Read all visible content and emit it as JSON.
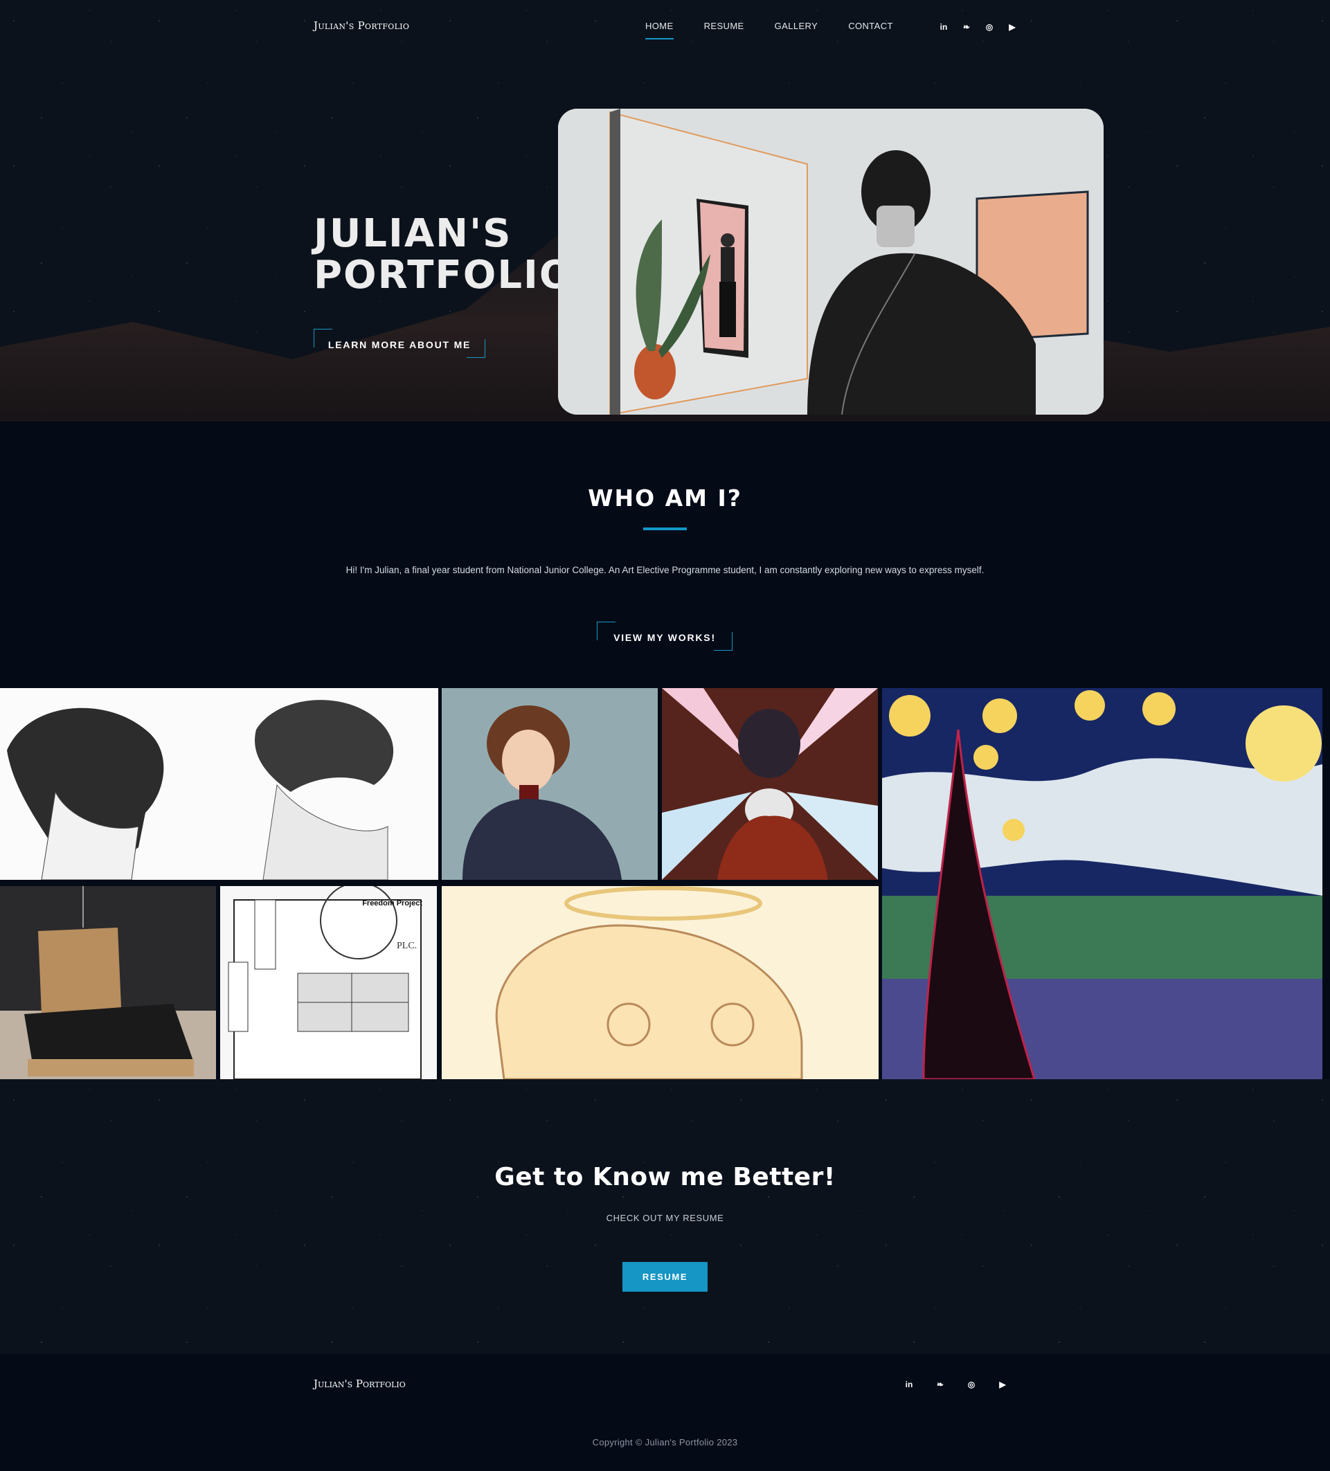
{
  "header": {
    "brand": "Julian's Portfolio",
    "nav": [
      {
        "label": "HOME",
        "active": true
      },
      {
        "label": "RESUME",
        "active": false
      },
      {
        "label": "GALLERY",
        "active": false
      },
      {
        "label": "CONTACT",
        "active": false
      }
    ],
    "socials": [
      {
        "icon": "linkedin-icon",
        "glyph": "in"
      },
      {
        "icon": "twitter-icon",
        "glyph": "❧"
      },
      {
        "icon": "instagram-icon",
        "glyph": "◎"
      },
      {
        "icon": "youtube-icon",
        "glyph": "▶"
      }
    ]
  },
  "hero": {
    "title_line1": "JULIAN'S",
    "title_line2": "PORTFOLIO",
    "cta": "LEARN MORE ABOUT ME"
  },
  "about": {
    "title": "WHO AM I?",
    "text": "Hi! I'm Julian, a final year student from National Junior College. An Art Elective Programme student, I am constantly exploring new ways to express myself.",
    "cta": "VIEW MY WORKS!"
  },
  "gallery": {
    "manga_page_label": "Freedom Project",
    "manga_sign": "PLC."
  },
  "resume_cta": {
    "title": "Get to Know me Better!",
    "subtitle": "CHECK OUT MY RESUME",
    "button": "RESUME"
  },
  "footer": {
    "brand": "Julian's Portfolio",
    "copyright": "Copyright © Julian's Portfolio 2023"
  },
  "colors": {
    "accent": "#1496c8",
    "background": "#040b17"
  }
}
